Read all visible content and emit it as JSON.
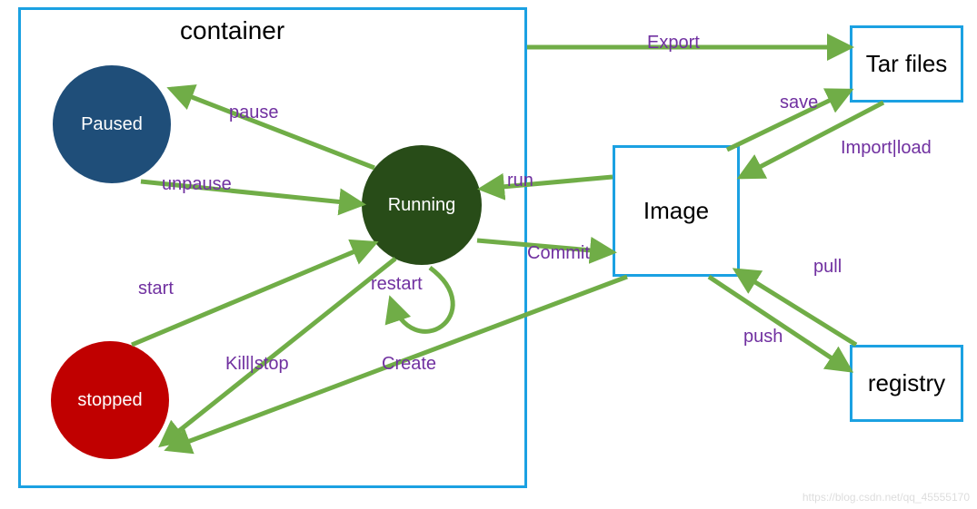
{
  "container": {
    "title": "container"
  },
  "states": {
    "paused": "Paused",
    "running": "Running",
    "stopped": "stopped"
  },
  "boxes": {
    "image": "Image",
    "tarfiles": "Tar files",
    "registry": "registry"
  },
  "edges": {
    "pause": "pause",
    "unpause": "unpause",
    "start": "start",
    "kill_stop": "Kill|stop",
    "restart": "restart",
    "run": "run",
    "commit": "Commit",
    "export": "Export",
    "save": "save",
    "import_load": "Import|load",
    "pull": "pull",
    "push": "push",
    "create": "Create"
  },
  "watermark": "https://blog.csdn.net/qq_45555170"
}
